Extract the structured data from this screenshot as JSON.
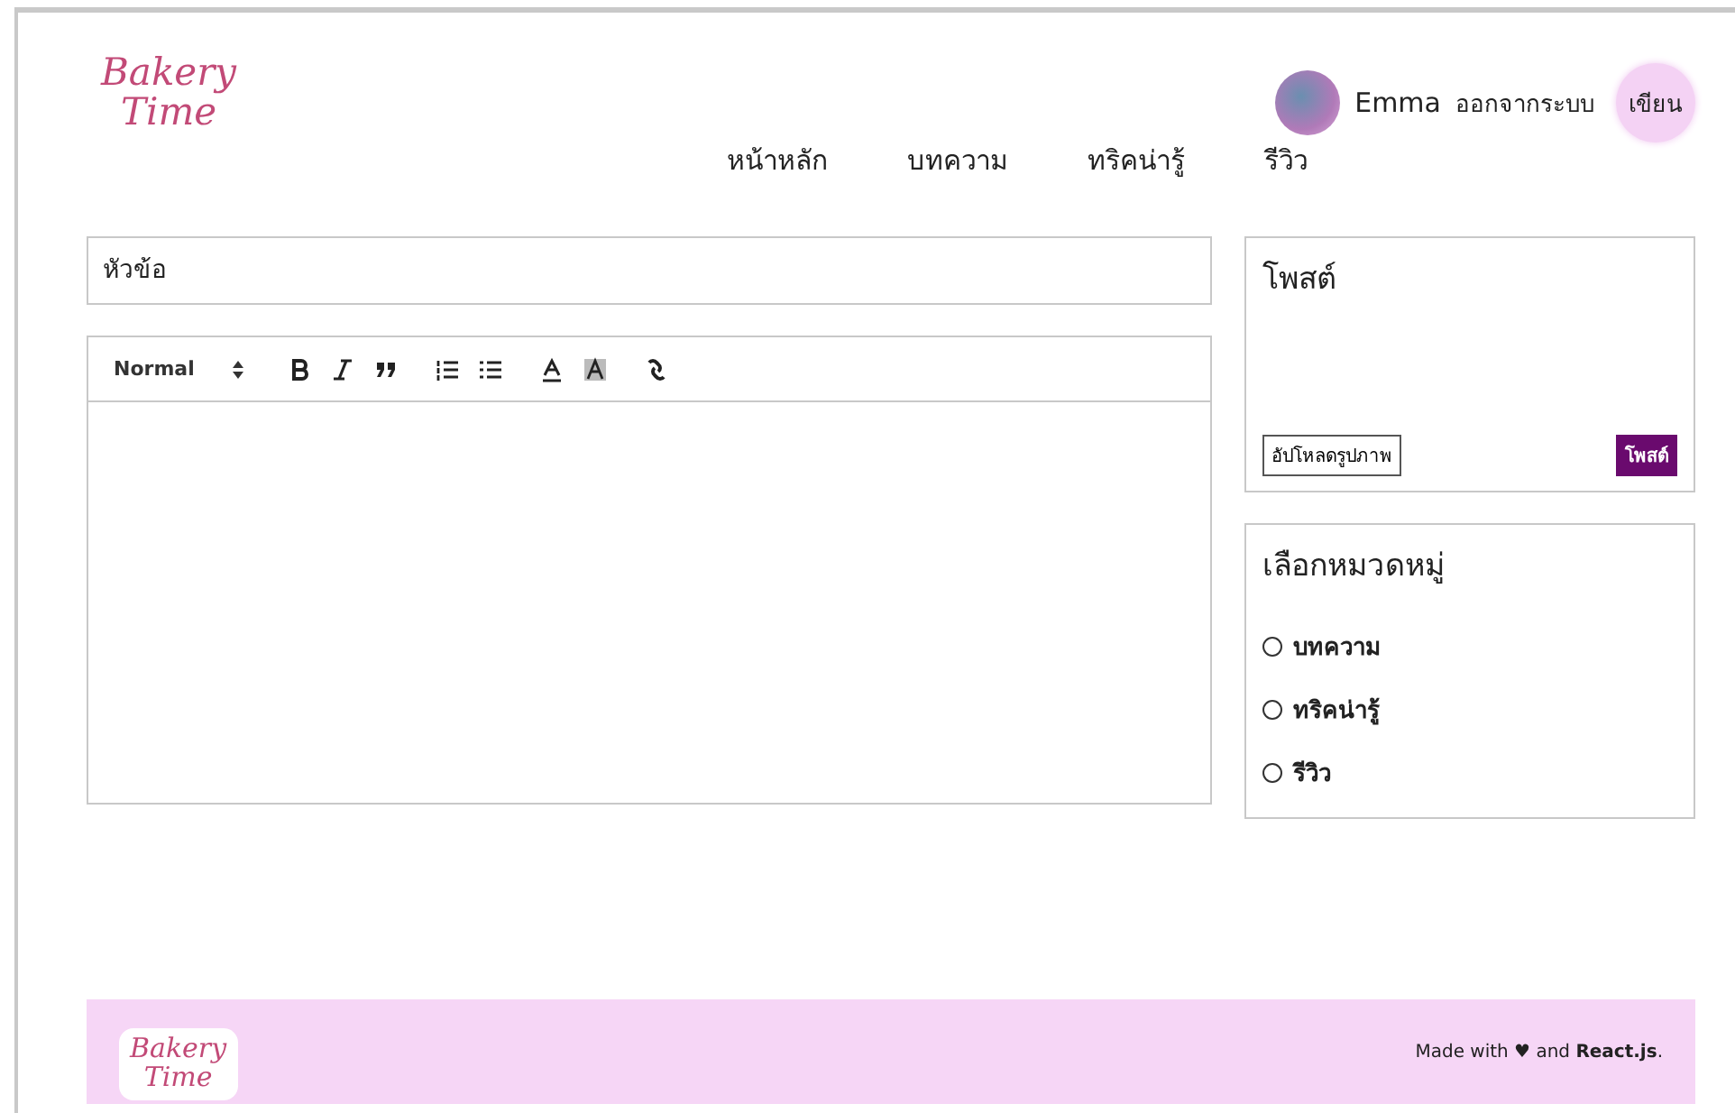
{
  "header": {
    "logo": [
      "Bakery",
      "Time"
    ],
    "user": {
      "name": "Emma"
    },
    "logout": "ออกจากระบบ",
    "write_button": "เขียน"
  },
  "nav": [
    "หน้าหลัก",
    "บทความ",
    "ทริคน่ารู้",
    "รีวิว"
  ],
  "title_field": {
    "placeholder": "หัวข้อ"
  },
  "editor": {
    "format_select": "Normal"
  },
  "post_panel": {
    "title": "โพสต์",
    "upload_button": "อัปโหลดรูปภาพ",
    "post_button": "โพสต์"
  },
  "category_panel": {
    "title": "เลือกหมวดหมู่",
    "options": [
      {
        "label": "บทความ",
        "selected": false
      },
      {
        "label": "ทริคน่ารู้",
        "selected": false
      },
      {
        "label": "รีวิว",
        "selected": false
      }
    ]
  },
  "footer": {
    "logo": [
      "Bakery",
      "Time"
    ],
    "credit": "Made with ♥ and **React.js**."
  }
}
